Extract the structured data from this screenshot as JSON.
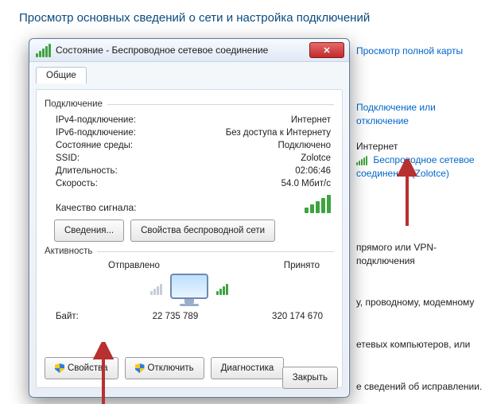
{
  "page": {
    "title": "Просмотр основных сведений о сети и настройка подключений"
  },
  "right": {
    "full_map": "Просмотр полной карты",
    "conn_or_disc": "Подключение или отключение",
    "internet": "Интернет",
    "wifi_link": "Беспроводное сетевое соединение (Zolotce)",
    "frag1": "прямого или VPN-подключения",
    "frag2": "у, проводному, модемному",
    "frag3": "етевых компьютеров, или",
    "frag4": "е сведений об исправлении."
  },
  "dialog": {
    "title": "Состояние - Беспроводное сетевое соединение",
    "tab_general": "Общие",
    "group_connection": "Подключение",
    "rows": {
      "ipv4_k": "IPv4-подключение:",
      "ipv4_v": "Интернет",
      "ipv6_k": "IPv6-подключение:",
      "ipv6_v": "Без доступа к Интернету",
      "media_k": "Состояние среды:",
      "media_v": "Подключено",
      "ssid_k": "SSID:",
      "ssid_v": "Zolotce",
      "dur_k": "Длительность:",
      "dur_v": "02:06:46",
      "speed_k": "Скорость:",
      "speed_v": "54.0 Мбит/с",
      "qual_k": "Качество сигнала:"
    },
    "btn_details": "Сведения...",
    "btn_wifi_props": "Свойства беспроводной сети",
    "group_activity": "Активность",
    "activity": {
      "sent": "Отправлено",
      "recv": "Принято",
      "bytes_label": "Байт:",
      "bytes_sent": "22 735 789",
      "bytes_recv": "320 174 670"
    },
    "btn_props": "Свойства",
    "btn_disable": "Отключить",
    "btn_diag": "Диагностика",
    "btn_close": "Закрыть"
  }
}
